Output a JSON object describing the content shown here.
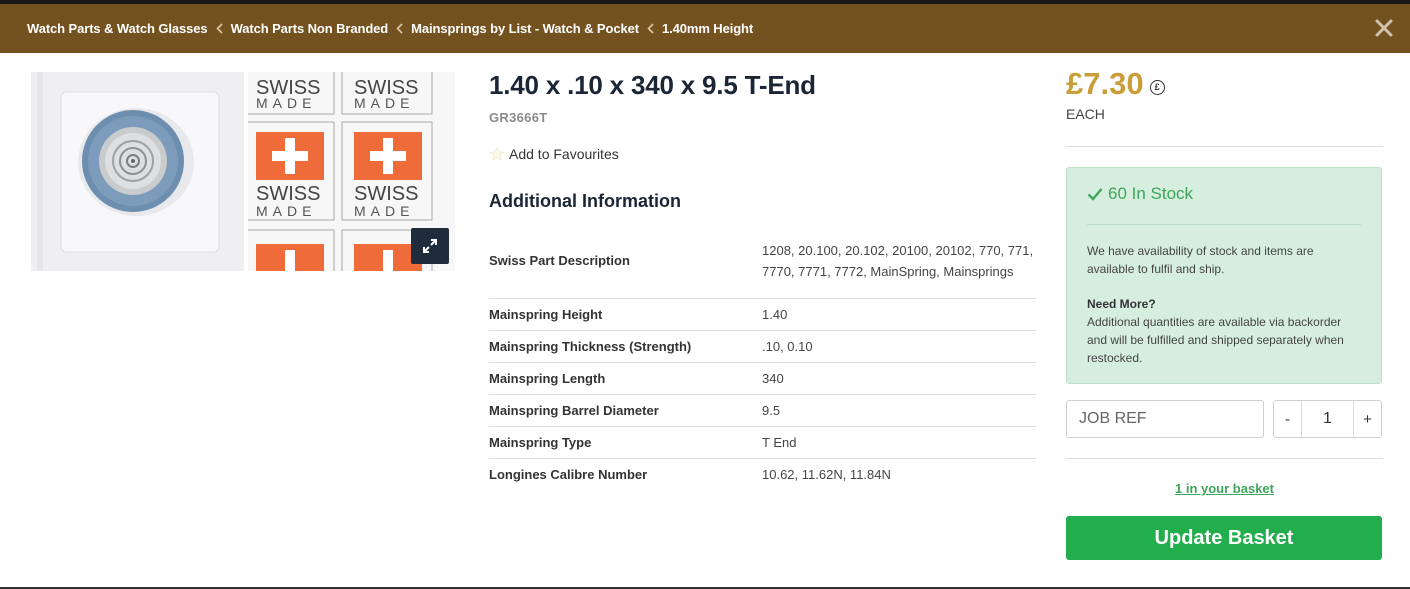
{
  "breadcrumb": [
    {
      "label": "Watch Parts & Watch Glasses"
    },
    {
      "label": "Watch Parts Non Branded"
    },
    {
      "label": "Mainsprings by List - Watch & Pocket"
    },
    {
      "label": "1.40mm Height"
    }
  ],
  "header": {
    "bg_color": "#73521f",
    "close_icon": "close-icon"
  },
  "gallery": {
    "swiss_label_top": "SWISS",
    "swiss_label_bottom": "MADE",
    "expand_icon": "expand-icon"
  },
  "product": {
    "title": "1.40 x .10 x 340 x 9.5 T-End",
    "sku": "GR3666T",
    "favourites_label": "Add to Favourites"
  },
  "additional": {
    "heading": "Additional Information",
    "rows": [
      {
        "key": "Swiss Part Description",
        "value": "1208, 20.100, 20.102, 20100, 20102, 770, 771, 7770, 7771, 7772, MainSpring, Mainsprings"
      },
      {
        "key": "Mainspring Height",
        "value": "1.40"
      },
      {
        "key": "Mainspring Thickness (Strength)",
        "value": ".10, 0.10"
      },
      {
        "key": "Mainspring Length",
        "value": "340"
      },
      {
        "key": "Mainspring Barrel Diameter",
        "value": "9.5"
      },
      {
        "key": "Mainspring Type",
        "value": "T End"
      },
      {
        "key": "Longines Calibre Number",
        "value": "10.62, 11.62N, 11.84N"
      }
    ]
  },
  "pricing": {
    "price": "£7.30",
    "currency_badge": "£",
    "unit": "EACH",
    "price_color": "#c99e3a"
  },
  "stock": {
    "heading": "60 In Stock",
    "availability_text": "We have availability of stock and items are available to fulfil and ship.",
    "need_more_title": "Need More?",
    "need_more_text": "Additional quantities are available via backorder and will be fulfilled and shipped separately when restocked.",
    "accent_color": "#3ea55c"
  },
  "order": {
    "jobref_placeholder": "JOB REF",
    "qty_minus": "-",
    "qty_value": "1",
    "qty_plus": "+",
    "basket_link": "1 in your basket",
    "update_button": "Update Basket",
    "button_color": "#22ae4d"
  }
}
